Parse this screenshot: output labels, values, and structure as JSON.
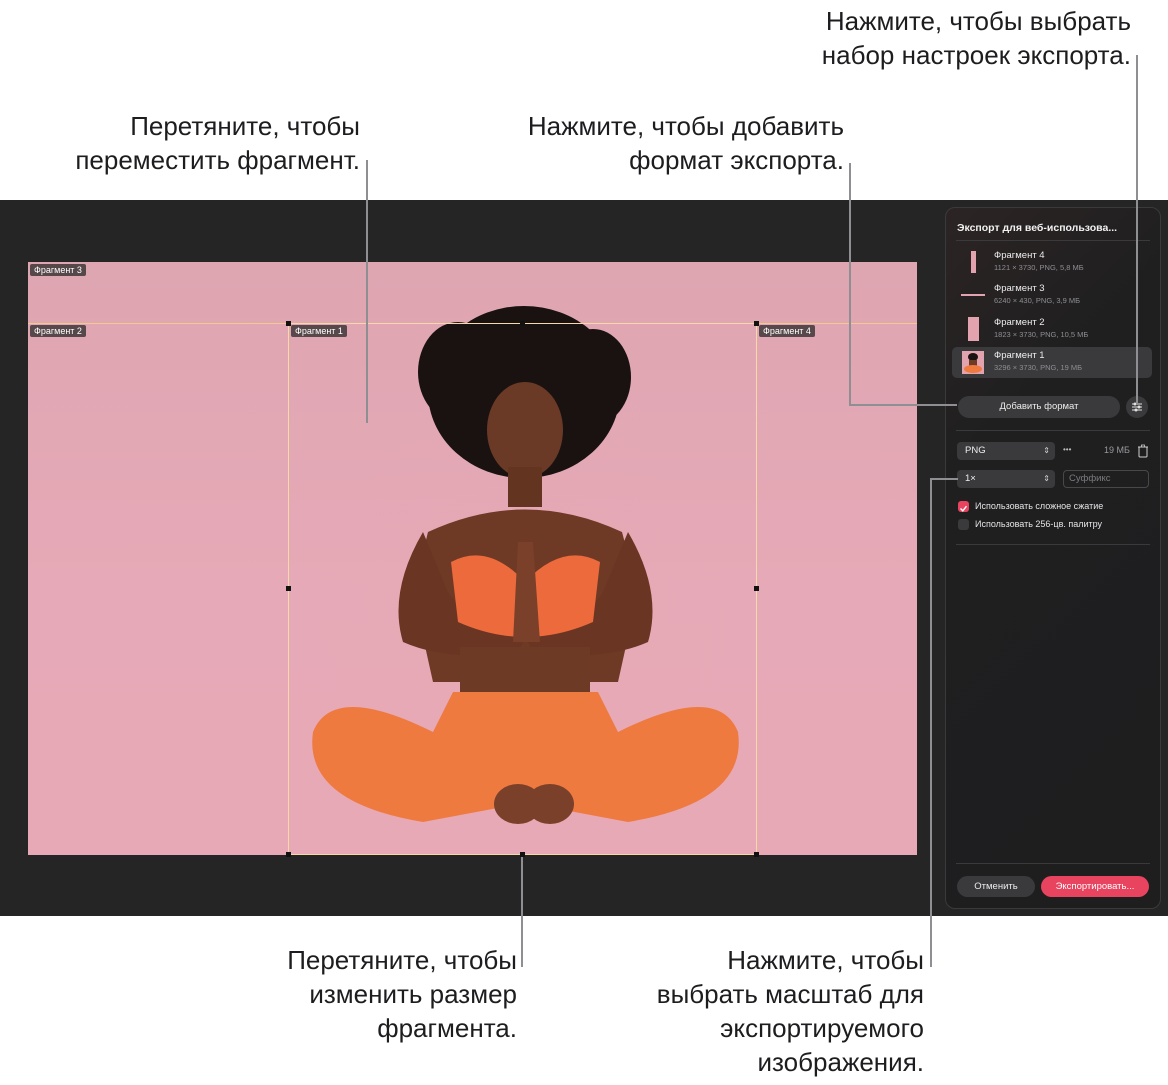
{
  "callouts": {
    "preset": [
      "Нажмите, чтобы выбрать",
      "набор настроек экспорта."
    ],
    "move": [
      "Перетяните, чтобы",
      "переместить фрагмент."
    ],
    "add_format": [
      "Нажмите, чтобы добавить",
      "формат экспорта."
    ],
    "resize": [
      "Перетяните, чтобы",
      "изменить размер",
      "фрагмента."
    ],
    "scale": [
      "Нажмите, чтобы",
      "выбрать масштаб для",
      "экспортируемого",
      "изображения."
    ]
  },
  "canvas": {
    "slice_labels": [
      "Фрагмент 3",
      "Фрагмент 2",
      "Фрагмент 1",
      "Фрагмент 4"
    ]
  },
  "panel": {
    "title": "Экспорт для веб-использова...",
    "slices": [
      {
        "name": "Фрагмент 4",
        "meta": "1121 × 3730, PNG, 5,8 МБ"
      },
      {
        "name": "Фрагмент 3",
        "meta": "6240 × 430, PNG, 3,9 МБ"
      },
      {
        "name": "Фрагмент 2",
        "meta": "1823 × 3730, PNG, 10,5 МБ"
      },
      {
        "name": "Фрагмент 1",
        "meta": "3296 × 3730, PNG, 19 МБ"
      }
    ],
    "add_format_label": "Добавить формат",
    "format_value": "PNG",
    "more_label": "•••",
    "file_size": "19 МБ",
    "scale_value": "1×",
    "suffix_placeholder": "Суффикс",
    "checkbox_compress": "Использовать сложное сжатие",
    "checkbox_palette": "Использовать 256-цв. палитру",
    "cancel_label": "Отменить",
    "export_label": "Экспортировать..."
  },
  "colors": {
    "accent": "#e8435f",
    "canvas_bg": "#252526",
    "panel_bg": "#1e1e1f",
    "slice_border": "#f2c98f"
  }
}
